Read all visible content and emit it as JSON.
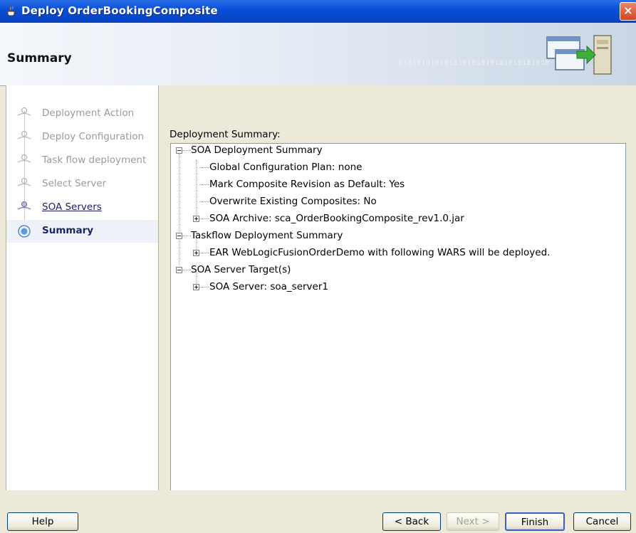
{
  "window": {
    "title": "Deploy OrderBookingComposite",
    "close_label": "×"
  },
  "banner": {
    "heading": "Summary",
    "binary_text": "010101010101010101010101010101010"
  },
  "steps": [
    {
      "label": "Deployment Action",
      "state": "done"
    },
    {
      "label": "Deploy Configuration",
      "state": "done"
    },
    {
      "label": "Task flow deployment",
      "state": "done"
    },
    {
      "label": "Select Server",
      "state": "done"
    },
    {
      "label": "SOA Servers",
      "state": "link"
    },
    {
      "label": "Summary",
      "state": "current"
    }
  ],
  "content": {
    "caption": "Deployment Summary:",
    "caption_mnemonic": "S",
    "tree": [
      {
        "text": "SOA Deployment Summary",
        "level": 0,
        "toggle": "minus"
      },
      {
        "text": "Global Configuration Plan: none",
        "level": 1,
        "toggle": "none"
      },
      {
        "text": "Mark Composite Revision as Default: Yes",
        "level": 1,
        "toggle": "none"
      },
      {
        "text": "Overwrite Existing Composites: No",
        "level": 1,
        "toggle": "none"
      },
      {
        "text": "SOA Archive: sca_OrderBookingComposite_rev1.0.jar",
        "level": 1,
        "toggle": "plus"
      },
      {
        "text": "Taskflow Deployment Summary",
        "level": 0,
        "toggle": "minus"
      },
      {
        "text": "EAR WebLogicFusionOrderDemo with following WARS will be deployed.",
        "level": 1,
        "toggle": "plus"
      },
      {
        "text": "SOA Server Target(s)",
        "level": 0,
        "toggle": "minus"
      },
      {
        "text": "SOA Server: soa_server1",
        "level": 1,
        "toggle": "plus"
      }
    ]
  },
  "buttons": {
    "help": {
      "label": "Help",
      "mnemonic": "H"
    },
    "back": {
      "label": "< Back",
      "mnemonic": "B"
    },
    "next": {
      "label": "Next >",
      "mnemonic": "N"
    },
    "finish": {
      "label": "Finish",
      "mnemonic": "F"
    },
    "cancel": {
      "label": "Cancel"
    }
  },
  "colors": {
    "title_bar": "#0a4fd8",
    "link_text": "#1c1c6c",
    "current_step_text": "#1a2566",
    "disabled_text": "#a4a294"
  }
}
